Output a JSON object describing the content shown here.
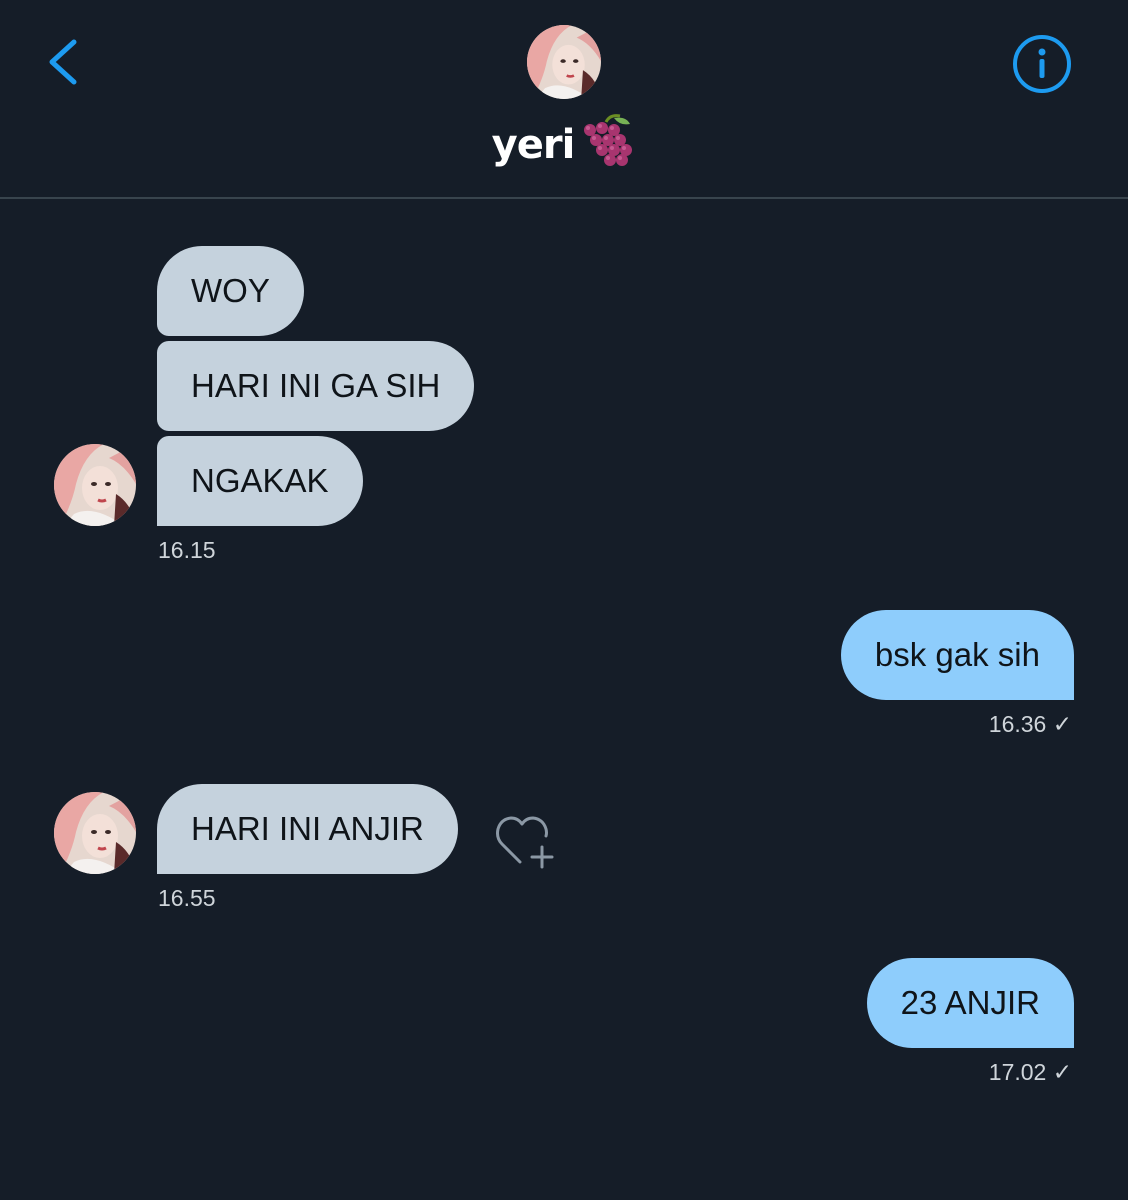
{
  "header": {
    "title": "yeri",
    "title_emoji": "grapes-icon",
    "back_icon": "chevron-left-icon",
    "info_icon": "info-icon"
  },
  "colors": {
    "background": "#151d28",
    "incoming_bubble": "#c5d2dd",
    "outgoing_bubble": "#8ecdfc",
    "accent": "#1d9bf0"
  },
  "messages": [
    {
      "from": "them",
      "text": "WOY"
    },
    {
      "from": "them",
      "text": "HARI INI GA SIH"
    },
    {
      "from": "them",
      "text": "NGAKAK",
      "time": "16.15"
    },
    {
      "from": "me",
      "text": "bsk gak sih",
      "time": "16.36 ✓"
    },
    {
      "from": "them",
      "text": "HARI INI ANJIR",
      "time": "16.55",
      "action": "heart-plus-icon"
    },
    {
      "from": "me",
      "text": "23 ANJIR",
      "time": "17.02 ✓"
    }
  ]
}
